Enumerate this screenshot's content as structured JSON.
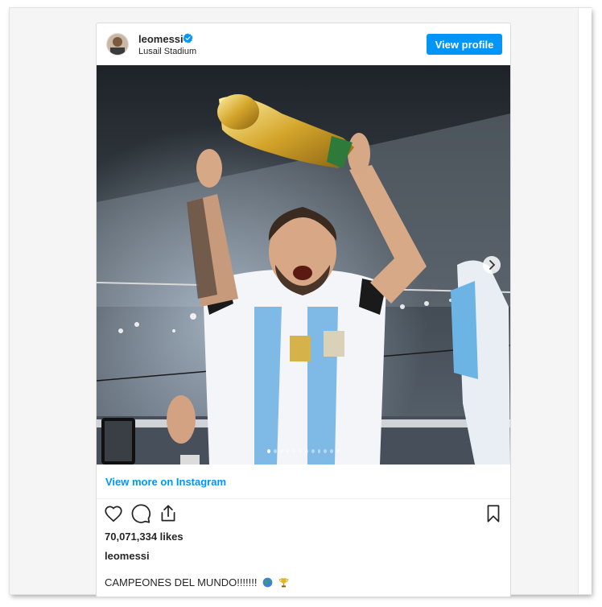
{
  "post": {
    "username": "leomessi",
    "location": "Lusail Stadium",
    "view_profile_label": "View profile",
    "view_more_label": "View more on Instagram",
    "likes": "70,071,334 likes",
    "caption_user": "leomessi",
    "caption_text": "CAMPEONES DEL MUNDO!!!!!!!",
    "caption_emojis": [
      "globe-icon",
      "trophy-icon"
    ],
    "carousel": {
      "slides": 12,
      "active_index": 0
    }
  },
  "colors": {
    "accent": "#0095f6",
    "text": "#262626",
    "border": "#dbdbdb",
    "verified": "#0095f6"
  },
  "icons": [
    "verified-badge-icon",
    "heart-icon",
    "comment-icon",
    "share-icon",
    "bookmark-icon",
    "chevron-right-icon"
  ]
}
